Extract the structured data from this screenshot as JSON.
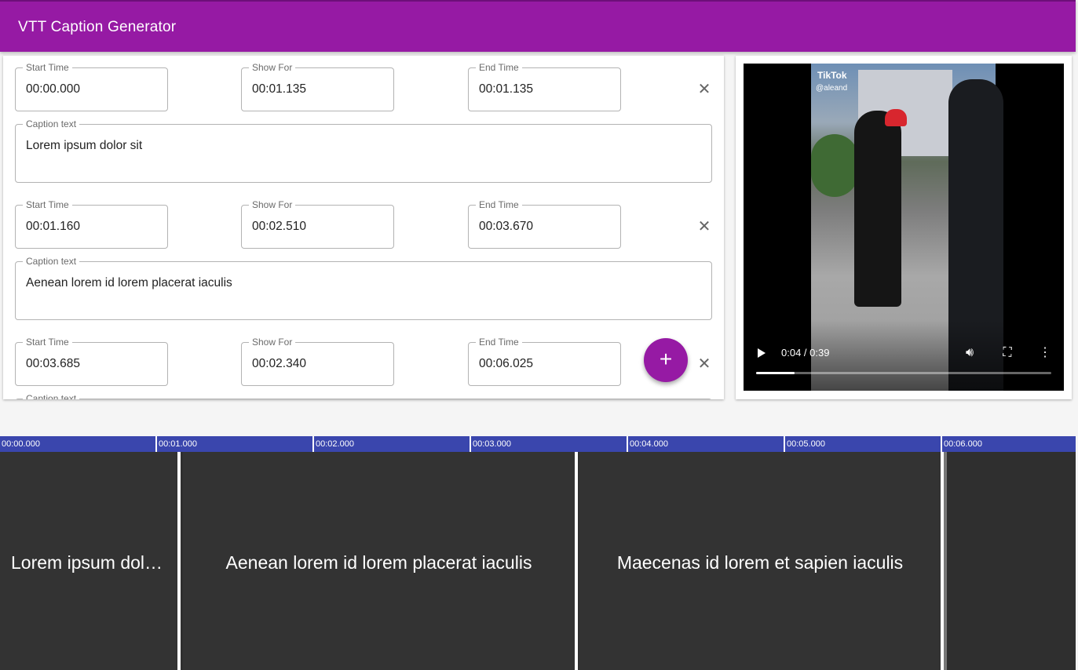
{
  "app": {
    "title": "VTT Caption Generator"
  },
  "labels": {
    "start": "Start Time",
    "show": "Show For",
    "end": "End Time",
    "caption": "Caption text"
  },
  "captions": [
    {
      "start": "00:00.000",
      "show": "00:01.135",
      "end": "00:01.135",
      "text": "Lorem ipsum dolor sit"
    },
    {
      "start": "00:01.160",
      "show": "00:02.510",
      "end": "00:03.670",
      "text": "Aenean lorem id lorem placerat iaculis"
    },
    {
      "start": "00:03.685",
      "show": "00:02.340",
      "end": "00:06.025",
      "text": ""
    }
  ],
  "actions": {
    "add": "+",
    "remove": "✕"
  },
  "player": {
    "time": "0:04 / 0:39",
    "progress": 0.13,
    "watermark": "TikTok",
    "handle": "@aleand"
  },
  "timeline": {
    "ticks": [
      "00:00.000",
      "00:01.000",
      "00:02.000",
      "00:03.000",
      "00:04.000",
      "00:05.000",
      "00:06.000"
    ],
    "clips": [
      "Lorem ipsum dolor sit",
      "Aenean lorem id lorem placerat iaculis",
      "Maecenas id lorem et sapien iaculis"
    ]
  },
  "colors": {
    "primary": "#961aa4",
    "ruler": "#3a46ad",
    "timeline_bg": "#333333"
  }
}
